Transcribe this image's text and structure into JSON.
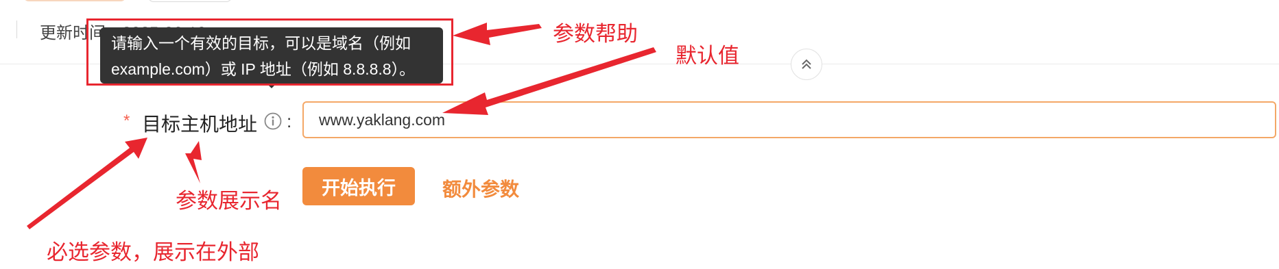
{
  "header": {
    "update_time": "更新时间：2025-06-19"
  },
  "tooltip": {
    "line1": "请输入一个有效的目标，可以是域名（例如",
    "line2": "example.com）或 IP 地址（例如 8.8.8.8）。"
  },
  "form": {
    "required_mark": "*",
    "field_label": "目标主机地址",
    "colon": ":",
    "target_value": "www.yaklang.com",
    "info_icon": "info-circle-icon"
  },
  "actions": {
    "start_label": "开始执行",
    "extra_label": "额外参数"
  },
  "collapse_icon": "double-chevron-up-icon",
  "annotations": {
    "param_help": "参数帮助",
    "default_value": "默认值",
    "display_name": "参数展示名",
    "required_outside": "必选参数，展示在外部",
    "color": "#e8262f"
  },
  "colors": {
    "accent": "#f28b3d",
    "input_border": "#f4a766",
    "tooltip_bg": "#333333",
    "required": "#f5604f"
  }
}
